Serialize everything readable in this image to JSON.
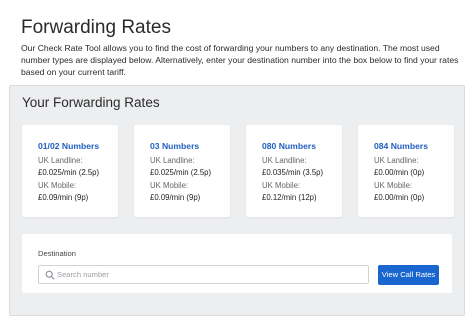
{
  "header": {
    "title": "Forwarding Rates",
    "intro": "Our Check Rate Tool allows you to find the cost of forwarding your numbers to any destination. The most used number types are displayed below. Alternatively, enter your destination number into the box below to find your rates based on your current tariff."
  },
  "rates_panel": {
    "title": "Your Forwarding Rates",
    "cards": [
      {
        "title": "01/02 Numbers",
        "landline_label": "UK Landline:",
        "landline_value": "£0.025/min (2.5p)",
        "mobile_label": "UK Mobile:",
        "mobile_value": "£0.09/min (9p)"
      },
      {
        "title": "03 Numbers",
        "landline_label": "UK Landline:",
        "landline_value": "£0.025/min (2.5p)",
        "mobile_label": "UK Mobile:",
        "mobile_value": "£0.09/min (9p)"
      },
      {
        "title": "080 Numbers",
        "landline_label": "UK Landline:",
        "landline_value": "£0.035/min (3.5p)",
        "mobile_label": "UK Mobile:",
        "mobile_value": "£0.12/min (12p)"
      },
      {
        "title": "084 Numbers",
        "landline_label": "UK Landline:",
        "landline_value": "£0.00/min (0p)",
        "mobile_label": "UK Mobile:",
        "mobile_value": "£0.00/min (0p)"
      }
    ]
  },
  "destination": {
    "label": "Destination",
    "placeholder": "Search number",
    "value": "",
    "button_label": "View Call Rates",
    "icon": "search-icon"
  },
  "colors": {
    "accent": "#1a66d1",
    "card_title": "#1f5fbf",
    "panel_bg": "#edeef0"
  }
}
